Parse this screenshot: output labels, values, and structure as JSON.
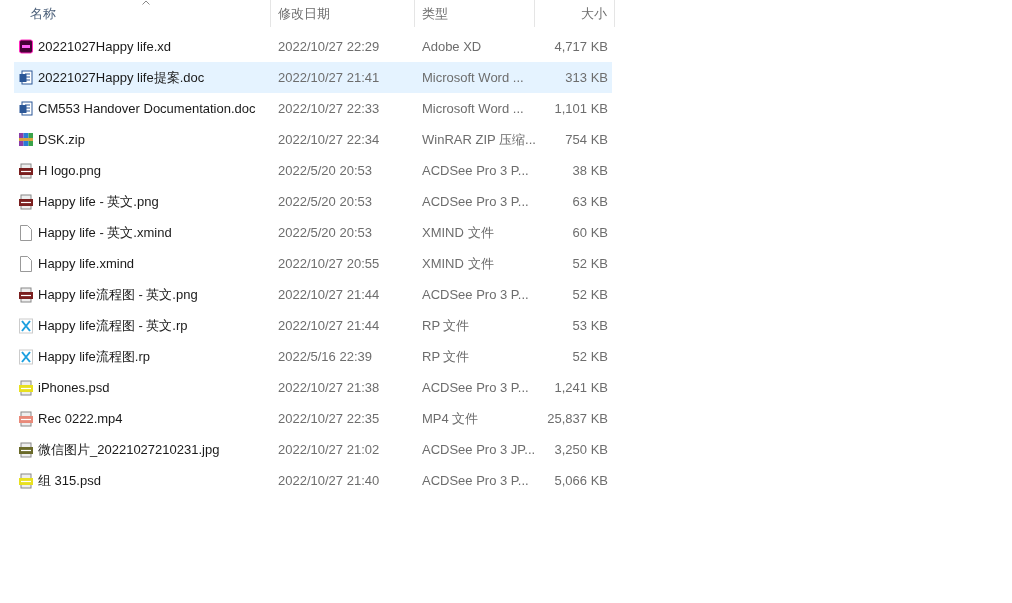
{
  "columns": [
    {
      "label": "名称",
      "sorted": true
    },
    {
      "label": "修改日期",
      "sorted": false
    },
    {
      "label": "类型",
      "sorted": false
    },
    {
      "label": "大小",
      "sorted": false
    }
  ],
  "files": [
    {
      "kind": "xd",
      "name": "20221027Happy life.xd",
      "modified": "2022/10/27 22:29",
      "type": "Adobe XD",
      "size": "4,717 KB",
      "selected": false
    },
    {
      "kind": "word",
      "name": "20221027Happy life提案.doc",
      "modified": "2022/10/27 21:41",
      "type": "Microsoft Word ...",
      "size": "313 KB",
      "selected": true
    },
    {
      "kind": "word",
      "name": "CM553 Handover Documentation.doc",
      "modified": "2022/10/27 22:33",
      "type": "Microsoft Word ...",
      "size": "1,101 KB",
      "selected": false
    },
    {
      "kind": "zip",
      "name": "DSK.zip",
      "modified": "2022/10/27 22:34",
      "type": "WinRAR ZIP 压缩...",
      "size": "754 KB",
      "selected": false
    },
    {
      "kind": "png",
      "name": "H logo.png",
      "modified": "2022/5/20 20:53",
      "type": "ACDSee Pro 3 P...",
      "size": "38 KB",
      "selected": false
    },
    {
      "kind": "png",
      "name": "Happy life - 英文.png",
      "modified": "2022/5/20 20:53",
      "type": "ACDSee Pro 3 P...",
      "size": "63 KB",
      "selected": false
    },
    {
      "kind": "file",
      "name": "Happy life - 英文.xmind",
      "modified": "2022/5/20 20:53",
      "type": "XMIND 文件",
      "size": "60 KB",
      "selected": false
    },
    {
      "kind": "file",
      "name": "Happy life.xmind",
      "modified": "2022/10/27 20:55",
      "type": "XMIND 文件",
      "size": "52 KB",
      "selected": false
    },
    {
      "kind": "png",
      "name": "Happy life流程图 - 英文.png",
      "modified": "2022/10/27 21:44",
      "type": "ACDSee Pro 3 P...",
      "size": "52 KB",
      "selected": false
    },
    {
      "kind": "rp",
      "name": "Happy life流程图 - 英文.rp",
      "modified": "2022/10/27 21:44",
      "type": "RP 文件",
      "size": "53 KB",
      "selected": false
    },
    {
      "kind": "rp",
      "name": "Happy life流程图.rp",
      "modified": "2022/5/16 22:39",
      "type": "RP 文件",
      "size": "52 KB",
      "selected": false
    },
    {
      "kind": "psd",
      "name": "iPhones.psd",
      "modified": "2022/10/27 21:38",
      "type": "ACDSee Pro 3 P...",
      "size": "1,241 KB",
      "selected": false
    },
    {
      "kind": "mp4",
      "name": "Rec 0222.mp4",
      "modified": "2022/10/27 22:35",
      "type": "MP4 文件",
      "size": "25,837 KB",
      "selected": false
    },
    {
      "kind": "jpg",
      "name": "微信图片_20221027210231.jpg",
      "modified": "2022/10/27 21:02",
      "type": "ACDSee Pro 3 JP...",
      "size": "3,250 KB",
      "selected": false
    },
    {
      "kind": "psd",
      "name": "组 315.psd",
      "modified": "2022/10/27 21:40",
      "type": "ACDSee Pro 3 P...",
      "size": "5,066 KB",
      "selected": false
    }
  ]
}
